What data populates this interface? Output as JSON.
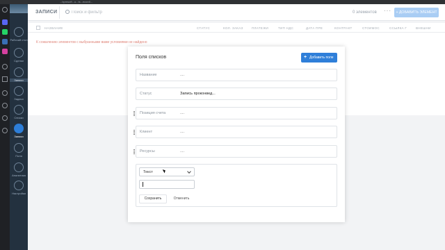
{
  "browser": {
    "url": "...bpmsoft...u...ts...ecord/..."
  },
  "sidebar": {
    "items": [
      {
        "label": "Рабочий стол"
      },
      {
        "label": "Сделки"
      },
      {
        "label": "Записи"
      },
      {
        "label": "Задачи"
      },
      {
        "label": "Списки"
      },
      {
        "label": "Записи"
      },
      {
        "label": "Поля"
      },
      {
        "label": "Аналитика"
      },
      {
        "label": "Настройки"
      }
    ]
  },
  "header": {
    "title": "ЗАПИСИ",
    "search_placeholder": "Поиск и фильтр",
    "count": "0 элементов",
    "more": "···",
    "add_element": "+ ДОБАВИТЬ ЭЛЕМЕНТ"
  },
  "table": {
    "columns": [
      "НАЗВАНИЕ",
      "СТАТУС",
      "КОЛ. ЗАКАЗ",
      "ПЛАТЕЖИ",
      "ТИП НДС",
      "ДАТА ПРЕ",
      "КОНТРАКТ",
      "СТОИМОС",
      "ССЫЛКА Г",
      "ВНЕШНИ"
    ],
    "empty_message": "К сожалению элементов с выбранными вами условиями не найдено"
  },
  "modal": {
    "title": "Поля списков",
    "add_field_label": "Добавить поле",
    "fields": [
      {
        "name": "Название",
        "value": "...."
      },
      {
        "name": "Статус",
        "value": "Запись проконвед..."
      },
      {
        "name": "Позиция счета",
        "value": "...."
      },
      {
        "name": "Клиент",
        "value": "...."
      },
      {
        "name": "Ресурсы",
        "value": "...."
      }
    ],
    "new_field": {
      "type_value": "Текст",
      "name_value": "",
      "save_label": "Сохранить",
      "cancel_label": "Отменить"
    }
  },
  "colors": {
    "accent": "#2f7fd9",
    "accent_light": "#a9cdf4",
    "sidebar_bg": "#23313f",
    "warning_text": "#e0877c"
  },
  "icons": {
    "dock": [
      "home-icon",
      "messenger-icon",
      "whatsapp-icon",
      "vk-icon",
      "instagram-icon",
      "settings-icon",
      "play-icon",
      "clock-icon",
      "history-icon",
      "gear-icon",
      "bulb-icon"
    ]
  }
}
